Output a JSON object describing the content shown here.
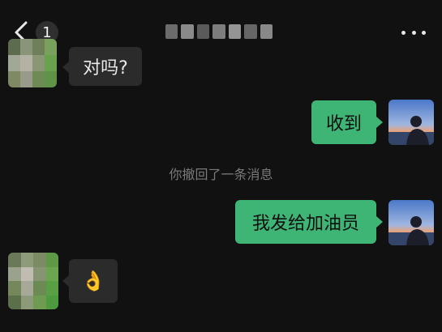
{
  "header": {
    "unread_count": "1",
    "back_icon": "chevron-left-icon",
    "more_icon": "more-dots-icon"
  },
  "messages": [
    {
      "side": "in",
      "text": "对吗?"
    },
    {
      "side": "out",
      "text": "收到"
    },
    {
      "side": "out",
      "text": "我发给加油员"
    },
    {
      "side": "in",
      "emoji": "👌"
    }
  ],
  "system": {
    "recall_text": "你撤回了一条消息"
  },
  "colors": {
    "background": "#111111",
    "bubble_out": "#3eb575",
    "bubble_in": "#2b2b2b",
    "system_text": "#7a7a7a"
  }
}
